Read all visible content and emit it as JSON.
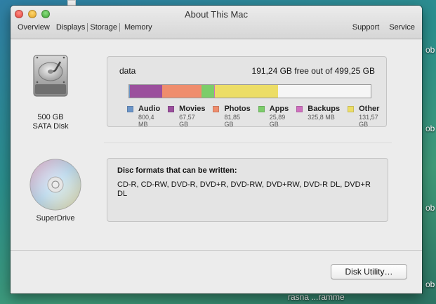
{
  "desktop": {
    "side_labels": [
      "ob",
      "ob",
      "ob",
      "ob"
    ],
    "bottom_label": "rasna ...ramme"
  },
  "window": {
    "title": "About This Mac",
    "tabs": [
      "Overview",
      "Displays",
      "Storage",
      "Memory"
    ],
    "selected_tab": "Storage",
    "links": [
      "Support",
      "Service"
    ]
  },
  "disk": {
    "size_label": "500 GB",
    "type_label": "SATA Disk",
    "volume_name": "data",
    "free_text": "191,24 GB free out of 499,25 GB",
    "legend": [
      {
        "name": "Audio",
        "size": "800,4 MB",
        "color": "#6b95c8"
      },
      {
        "name": "Movies",
        "size": "67,57 GB",
        "color": "#9b4f9d"
      },
      {
        "name": "Photos",
        "size": "81,85 GB",
        "color": "#ef8d6d"
      },
      {
        "name": "Apps",
        "size": "25,89 GB",
        "color": "#7ccd6a"
      },
      {
        "name": "Backups",
        "size": "325,8 MB",
        "color": "#cf70bf"
      },
      {
        "name": "Other",
        "size": "131,57 GB",
        "color": "#ecdd66"
      }
    ],
    "bar_fractions": [
      0.0016,
      0.1353,
      0.1639,
      0.0519,
      0.0007,
      0.2635
    ],
    "free_color": "#f5f5f5"
  },
  "superdrive": {
    "label": "SuperDrive",
    "heading": "Disc formats that can be written:",
    "formats": "CD-R, CD-RW, DVD-R, DVD+R, DVD-RW, DVD+RW, DVD-R DL, DVD+R DL"
  },
  "buttons": {
    "disk_utility": "Disk Utility…"
  }
}
